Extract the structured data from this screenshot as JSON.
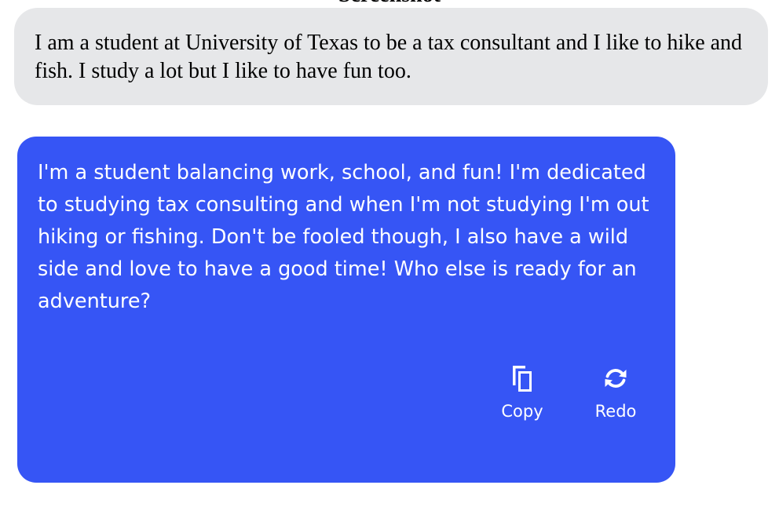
{
  "page": {
    "heading": "Screenshot"
  },
  "user_message": {
    "text": "I am a student at University of Texas to be a tax consultant and I like to hike and fish. I study a lot but I like to have fun too."
  },
  "bio_card": {
    "text": "I'm a student balancing work, school, and fun! I'm dedicated to studying tax consulting and when I'm not studying I'm out hiking or fishing. Don't be fooled though, I also have a wild side and love to have a good time! Who else is ready for an adventure?",
    "background_color": "#3655f5",
    "actions": {
      "copy": {
        "label": "Copy",
        "icon": "copy-icon"
      },
      "redo": {
        "label": "Redo",
        "icon": "refresh-icon"
      }
    }
  },
  "colors": {
    "user_bubble": "#e6e7e9",
    "card_text": "#ffffff"
  }
}
